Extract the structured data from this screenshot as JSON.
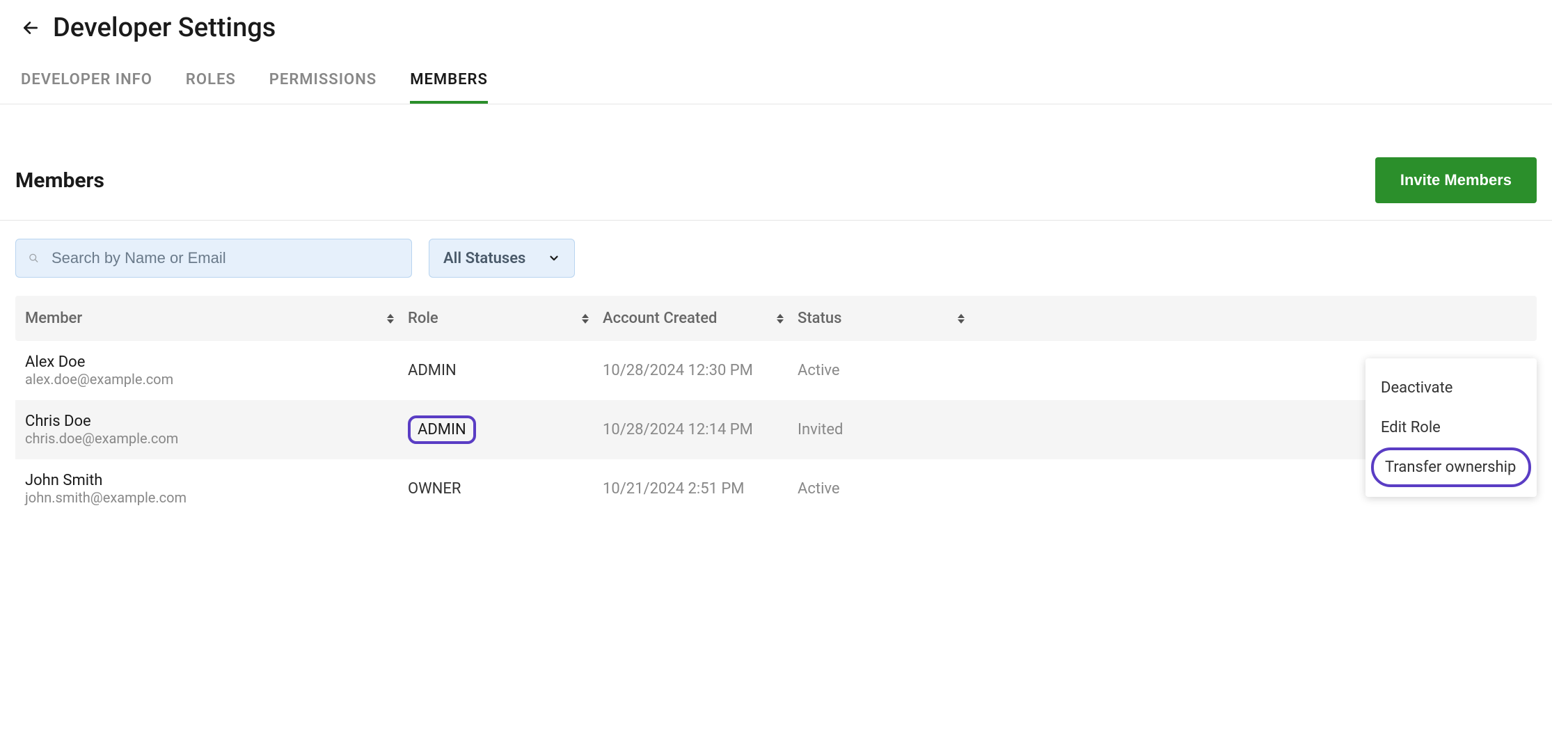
{
  "header": {
    "title": "Developer Settings"
  },
  "tabs": [
    {
      "label": "DEVELOPER INFO",
      "active": false
    },
    {
      "label": "ROLES",
      "active": false
    },
    {
      "label": "PERMISSIONS",
      "active": false
    },
    {
      "label": "MEMBERS",
      "active": true
    }
  ],
  "section": {
    "title": "Members",
    "invite_button": "Invite Members"
  },
  "filters": {
    "search_placeholder": "Search by Name or Email",
    "status_label": "All Statuses"
  },
  "table": {
    "columns": {
      "member": "Member",
      "role": "Role",
      "created": "Account Created",
      "status": "Status"
    },
    "rows": [
      {
        "name": "Alex Doe",
        "email": "alex.doe@example.com",
        "role": "ADMIN",
        "role_highlighted": false,
        "created": "10/28/2024 12:30 PM",
        "status": "Active",
        "row_highlighted": false
      },
      {
        "name": "Chris Doe",
        "email": "chris.doe@example.com",
        "role": "ADMIN",
        "role_highlighted": true,
        "created": "10/28/2024 12:14 PM",
        "status": "Invited",
        "row_highlighted": true
      },
      {
        "name": "John Smith",
        "email": "john.smith@example.com",
        "role": "OWNER",
        "role_highlighted": false,
        "created": "10/21/2024 2:51 PM",
        "status": "Active",
        "row_highlighted": false
      }
    ]
  },
  "context_menu": {
    "items": [
      {
        "label": "Deactivate",
        "highlighted": false
      },
      {
        "label": "Edit Role",
        "highlighted": false
      },
      {
        "label": "Transfer ownership",
        "highlighted": true
      }
    ]
  }
}
